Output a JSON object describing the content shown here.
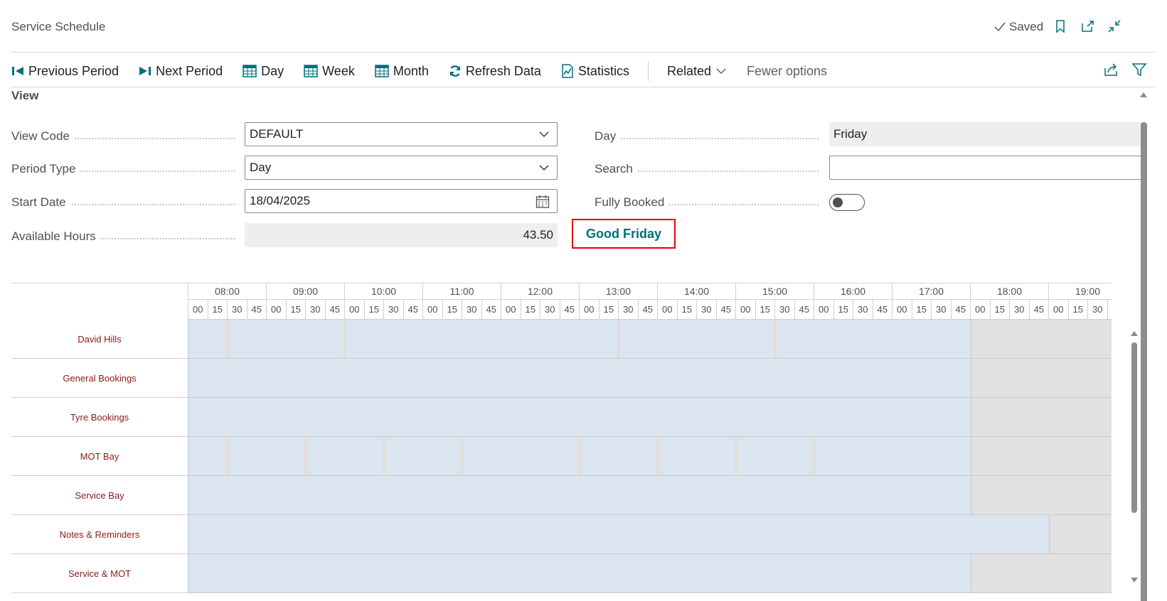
{
  "header": {
    "title": "Service Schedule",
    "saved_label": "Saved",
    "icons": [
      "bookmark-icon",
      "open-new-window-icon",
      "collapse-icon"
    ]
  },
  "actions": {
    "previous_period": "Previous Period",
    "next_period": "Next Period",
    "day": "Day",
    "week": "Week",
    "month": "Month",
    "refresh_data": "Refresh Data",
    "statistics": "Statistics",
    "related": "Related",
    "fewer_options": "Fewer options"
  },
  "form": {
    "section_title": "View",
    "view_code": {
      "label": "View Code",
      "value": "DEFAULT"
    },
    "period_type": {
      "label": "Period Type",
      "value": "Day"
    },
    "start_date": {
      "label": "Start Date",
      "value": "18/04/2025"
    },
    "available_hours": {
      "label": "Available Hours",
      "value": "43.50"
    },
    "day": {
      "label": "Day",
      "value": "Friday"
    },
    "search": {
      "label": "Search",
      "value": ""
    },
    "fully_booked": {
      "label": "Fully Booked",
      "value": false
    },
    "holiday_name": "Good Friday"
  },
  "schedule": {
    "hours": [
      "08:00",
      "09:00",
      "10:00",
      "11:00",
      "12:00",
      "13:00",
      "14:00",
      "15:00",
      "16:00",
      "17:00",
      "18:00",
      "19:00"
    ],
    "minutes": [
      "00",
      "15",
      "30",
      "45"
    ],
    "resources": [
      {
        "name": "David Hills",
        "open_until_hour": 18,
        "breaks": [
          "08:30",
          "10:00",
          "13:30",
          "15:30"
        ]
      },
      {
        "name": "General Bookings",
        "open_until_hour": 18,
        "breaks": []
      },
      {
        "name": "Tyre Bookings",
        "open_until_hour": 18,
        "breaks": []
      },
      {
        "name": "MOT Bay",
        "open_until_hour": 18,
        "breaks": [
          "08:30",
          "09:30",
          "10:30",
          "11:30",
          "13:00",
          "14:00",
          "15:00",
          "16:00"
        ]
      },
      {
        "name": "Service Bay",
        "open_until_hour": 18,
        "breaks": []
      },
      {
        "name": "Notes & Reminders",
        "open_until_hour": 19,
        "breaks": []
      },
      {
        "name": "Service & MOT",
        "open_until_hour": 18,
        "breaks": []
      }
    ]
  },
  "colors": {
    "accent": "#00707a",
    "open_slot": "#dbe5f0",
    "closed_slot": "#e1e1e1",
    "resource_label": "#8b1a1a",
    "highlight_border": "#e0000f"
  }
}
